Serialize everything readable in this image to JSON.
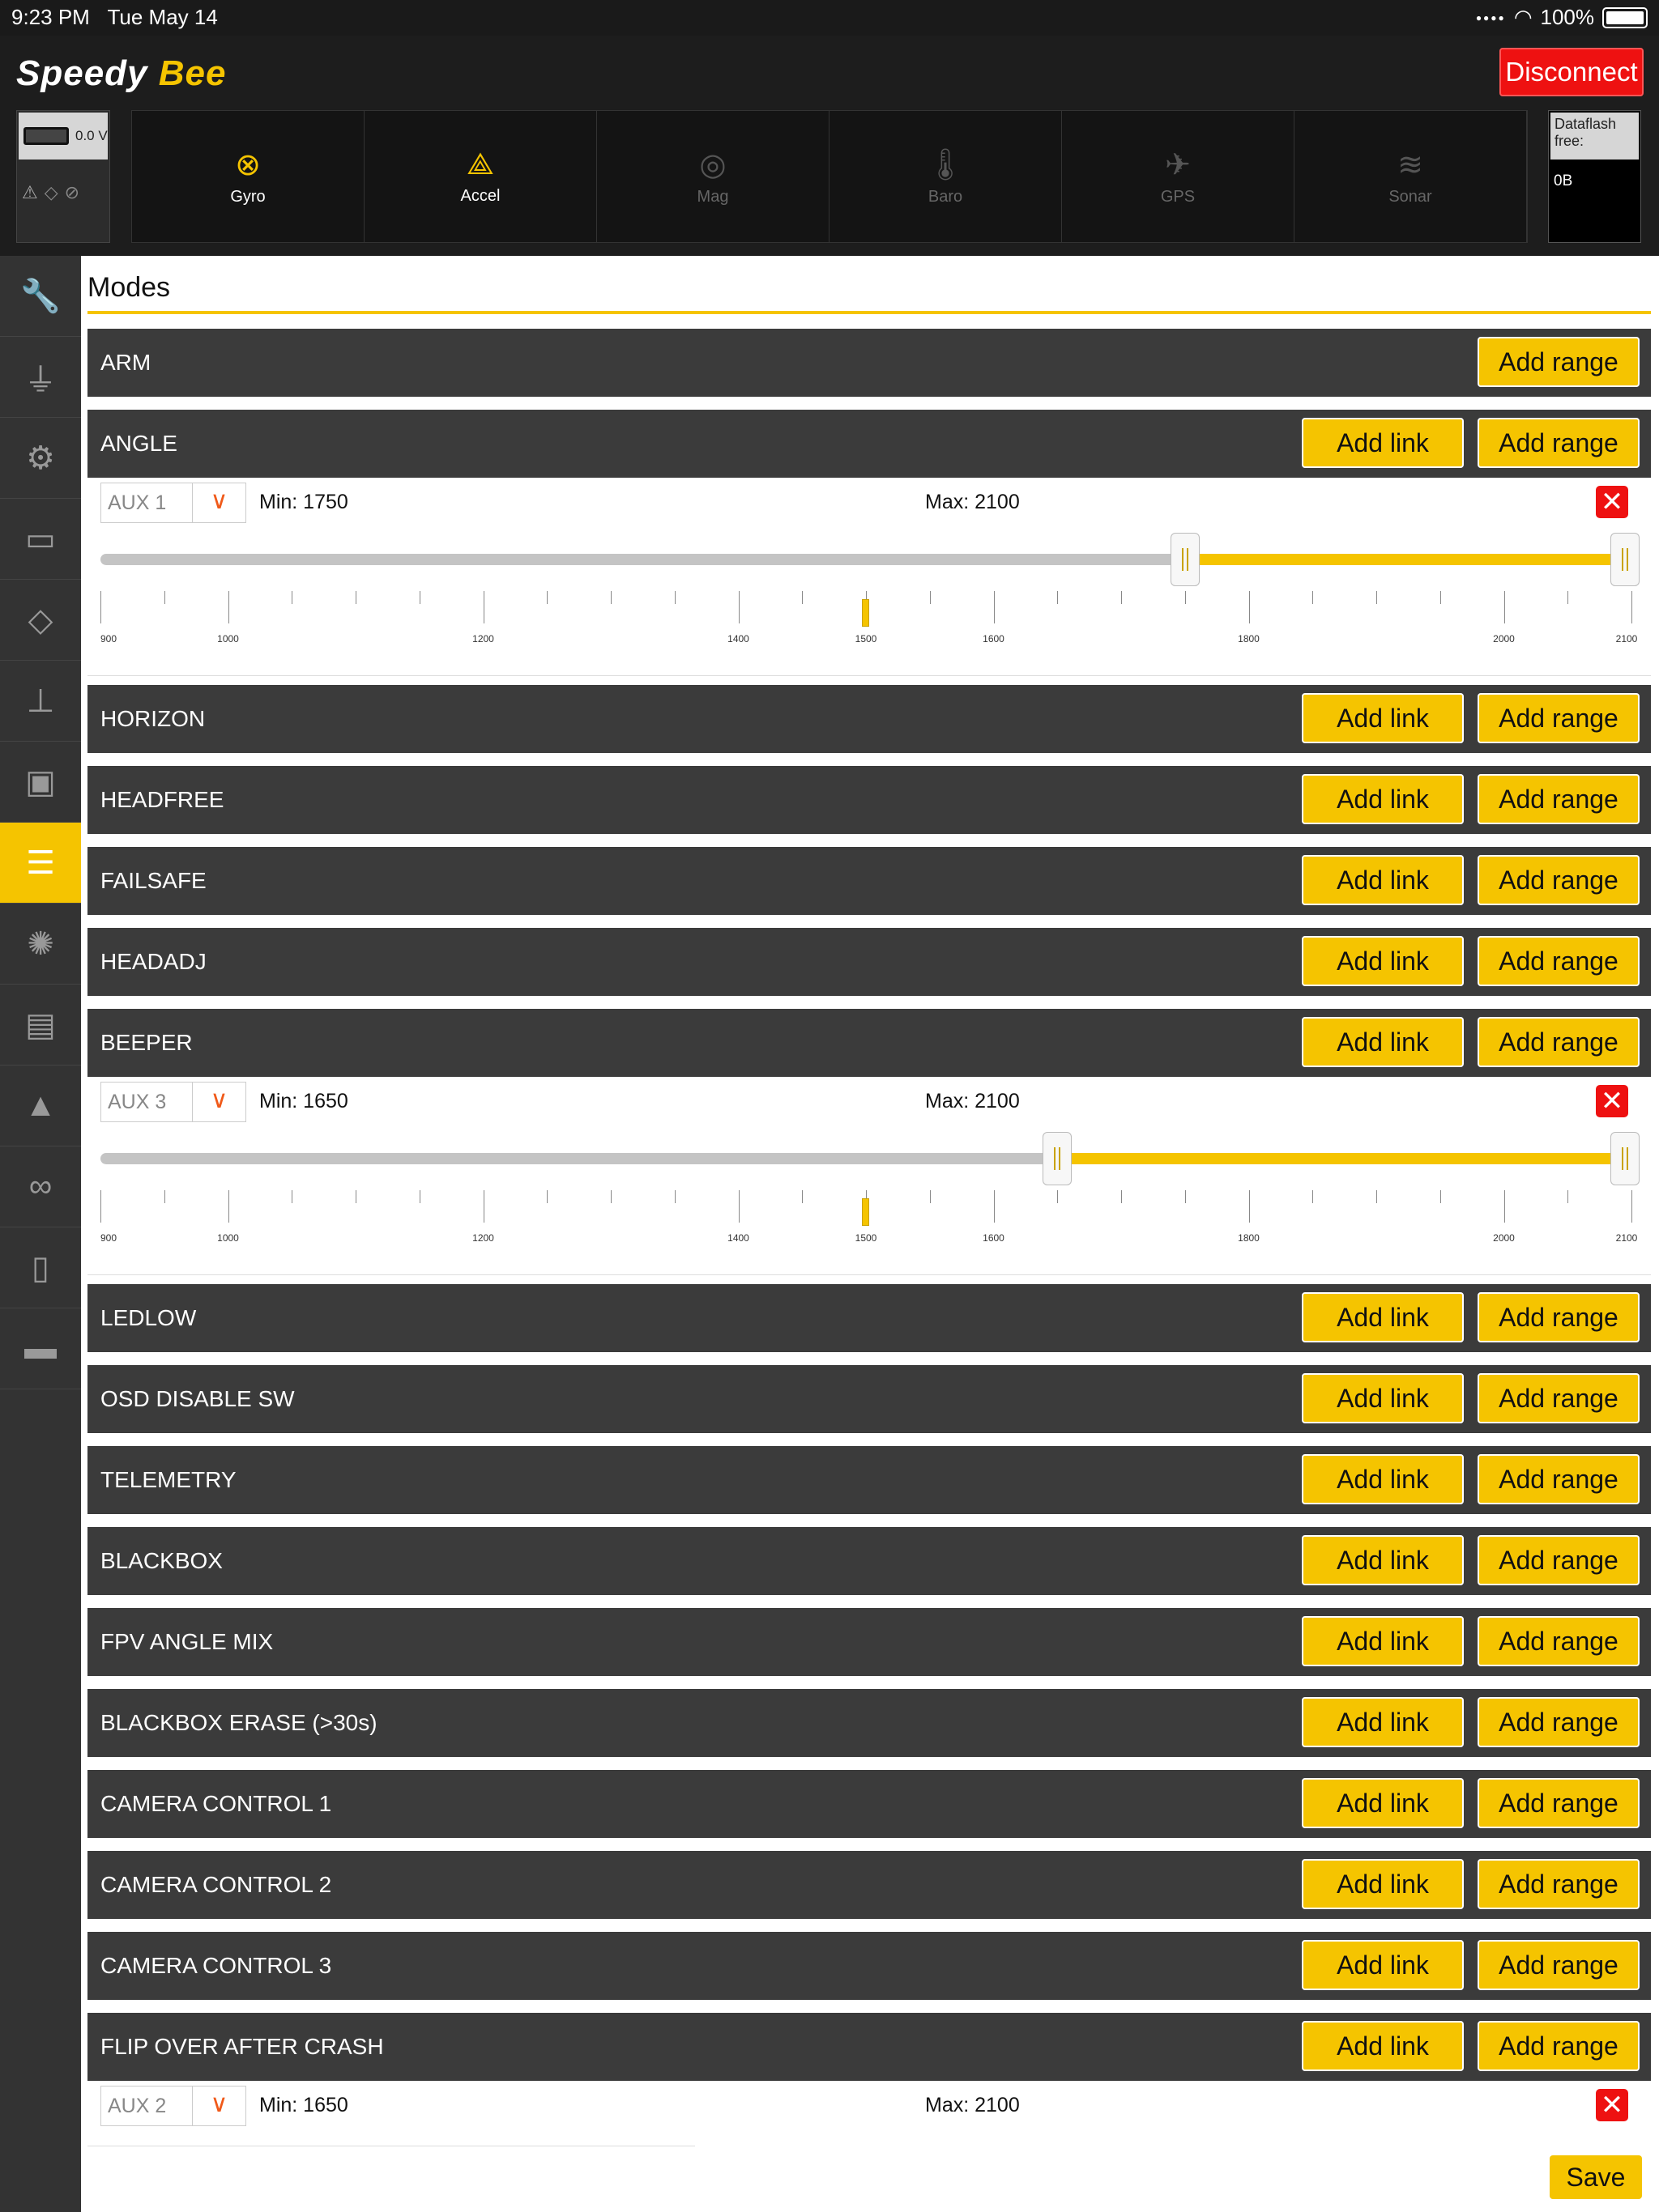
{
  "status_bar": {
    "time": "9:23 PM",
    "date": "Tue May 14",
    "battery": "100%"
  },
  "header": {
    "logo_speedy": "Speedy",
    "logo_bee": "Bee",
    "disconnect_label": "Disconnect",
    "battery_voltage": "0.0 V",
    "sensors": [
      {
        "label": "Gyro",
        "icon": "gyro-icon",
        "active": true
      },
      {
        "label": "Accel",
        "icon": "accel-icon",
        "active": true
      },
      {
        "label": "Mag",
        "icon": "compass-icon",
        "active": false
      },
      {
        "label": "Baro",
        "icon": "thermometer-icon",
        "active": false
      },
      {
        "label": "GPS",
        "icon": "satellite-icon",
        "active": false
      },
      {
        "label": "Sonar",
        "icon": "sonar-icon",
        "active": false
      }
    ],
    "dataflash_label": "Dataflash free:",
    "dataflash_value": "0B"
  },
  "sidebar": {
    "items": [
      {
        "icon": "wrench-icon"
      },
      {
        "icon": "plug-icon"
      },
      {
        "icon": "gear-icon"
      },
      {
        "icon": "battery-icon"
      },
      {
        "icon": "parachute-icon"
      },
      {
        "icon": "hierarchy-icon"
      },
      {
        "icon": "radio-controller-icon"
      },
      {
        "icon": "modes-icon",
        "active": true
      },
      {
        "icon": "motor-icon"
      },
      {
        "icon": "osd-icon"
      },
      {
        "icon": "siren-icon"
      },
      {
        "icon": "loop-icon"
      },
      {
        "icon": "receiver-icon"
      },
      {
        "icon": "window-icon"
      }
    ]
  },
  "page": {
    "title": "Modes",
    "add_link_label": "Add link",
    "add_range_label": "Add range",
    "save_label": "Save",
    "min_prefix": "Min: ",
    "max_prefix": "Max: ",
    "scale_labels": [
      "900",
      "1000",
      "1200",
      "1400",
      "1500",
      "1600",
      "1800",
      "2000",
      "2100"
    ],
    "modes": [
      {
        "name": "ARM",
        "has_link": false
      },
      {
        "name": "ANGLE",
        "has_link": true
      },
      {
        "name": "HORIZON",
        "has_link": true
      },
      {
        "name": "HEADFREE",
        "has_link": true
      },
      {
        "name": "FAILSAFE",
        "has_link": true
      },
      {
        "name": "HEADADJ",
        "has_link": true
      },
      {
        "name": "BEEPER",
        "has_link": true
      },
      {
        "name": "LEDLOW",
        "has_link": true
      },
      {
        "name": "OSD DISABLE SW",
        "has_link": true
      },
      {
        "name": "TELEMETRY",
        "has_link": true
      },
      {
        "name": "BLACKBOX",
        "has_link": true
      },
      {
        "name": "FPV ANGLE MIX",
        "has_link": true
      },
      {
        "name": "BLACKBOX ERASE (>30s)",
        "has_link": true
      },
      {
        "name": "CAMERA CONTROL 1",
        "has_link": true
      },
      {
        "name": "CAMERA CONTROL 2",
        "has_link": true
      },
      {
        "name": "CAMERA CONTROL 3",
        "has_link": true
      },
      {
        "name": "FLIP OVER AFTER CRASH",
        "has_link": true
      }
    ],
    "ranges": [
      {
        "mode": "ANGLE",
        "aux": "AUX 1",
        "min": "1750",
        "max": "2100",
        "min_value": 1750,
        "max_value": 2100,
        "channel_value": 1500
      },
      {
        "mode": "BEEPER",
        "aux": "AUX 3",
        "min": "1650",
        "max": "2100",
        "min_value": 1650,
        "max_value": 2100,
        "channel_value": 1500
      },
      {
        "mode": "FLIP OVER AFTER CRASH",
        "aux": "AUX 2",
        "min": "1650",
        "max": "2100",
        "min_value": 1650,
        "max_value": 2100
      }
    ]
  }
}
